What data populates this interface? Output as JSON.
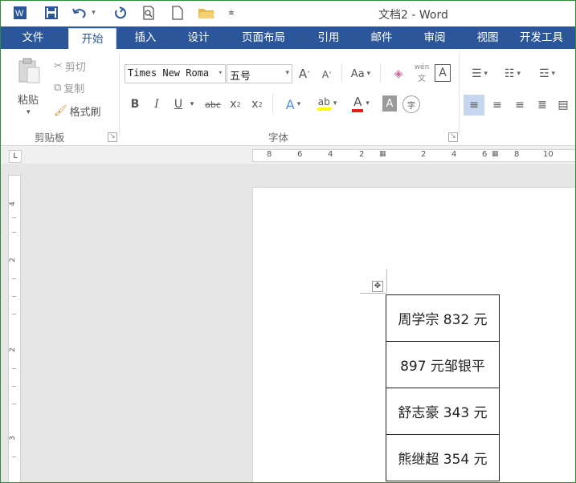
{
  "window": {
    "title": "文档2 - Word"
  },
  "tabs": [
    {
      "label": "文件"
    },
    {
      "label": "开始"
    },
    {
      "label": "插入"
    },
    {
      "label": "设计"
    },
    {
      "label": "页面布局"
    },
    {
      "label": "引用"
    },
    {
      "label": "邮件"
    },
    {
      "label": "审阅"
    },
    {
      "label": "视图"
    },
    {
      "label": "开发工具"
    }
  ],
  "active_tab": "开始",
  "clipboard": {
    "paste_label": "粘贴",
    "cut_label": "剪切",
    "copy_label": "复制",
    "format_painter_label": "格式刷",
    "group_label": "剪贴板"
  },
  "font": {
    "font_name": "Times New Roma",
    "font_size": "五号",
    "grow_label": "A",
    "shrink_label": "A",
    "case_label": "Aa",
    "phonetic_label": "wén",
    "border_char_label": "A",
    "bold_label": "B",
    "italic_label": "I",
    "underline_label": "U",
    "strike_label": "abc",
    "subscript_label": "x",
    "superscript_label": "x",
    "effects_label": "A",
    "highlight_label": "ab",
    "color_label": "A",
    "shading_label": "A",
    "enclose_label": "字",
    "group_label": "字体"
  },
  "ruler": {
    "tab_selector": "L",
    "h_numbers": [
      "8",
      "6",
      "4",
      "2",
      "2",
      "4",
      "6",
      "8",
      "10"
    ],
    "v_numbers": [
      "4",
      "2",
      "2",
      "3"
    ]
  },
  "document": {
    "cells": [
      {
        "text": "周学宗 832 元"
      },
      {
        "text": "897 元邹银平"
      },
      {
        "text": "舒志豪 343 元"
      },
      {
        "text": "熊继超 354 元"
      }
    ]
  },
  "colors": {
    "ribbon_blue": "#2b579a",
    "highlight_yellow": "#ffff00",
    "font_red": "#e02020"
  }
}
